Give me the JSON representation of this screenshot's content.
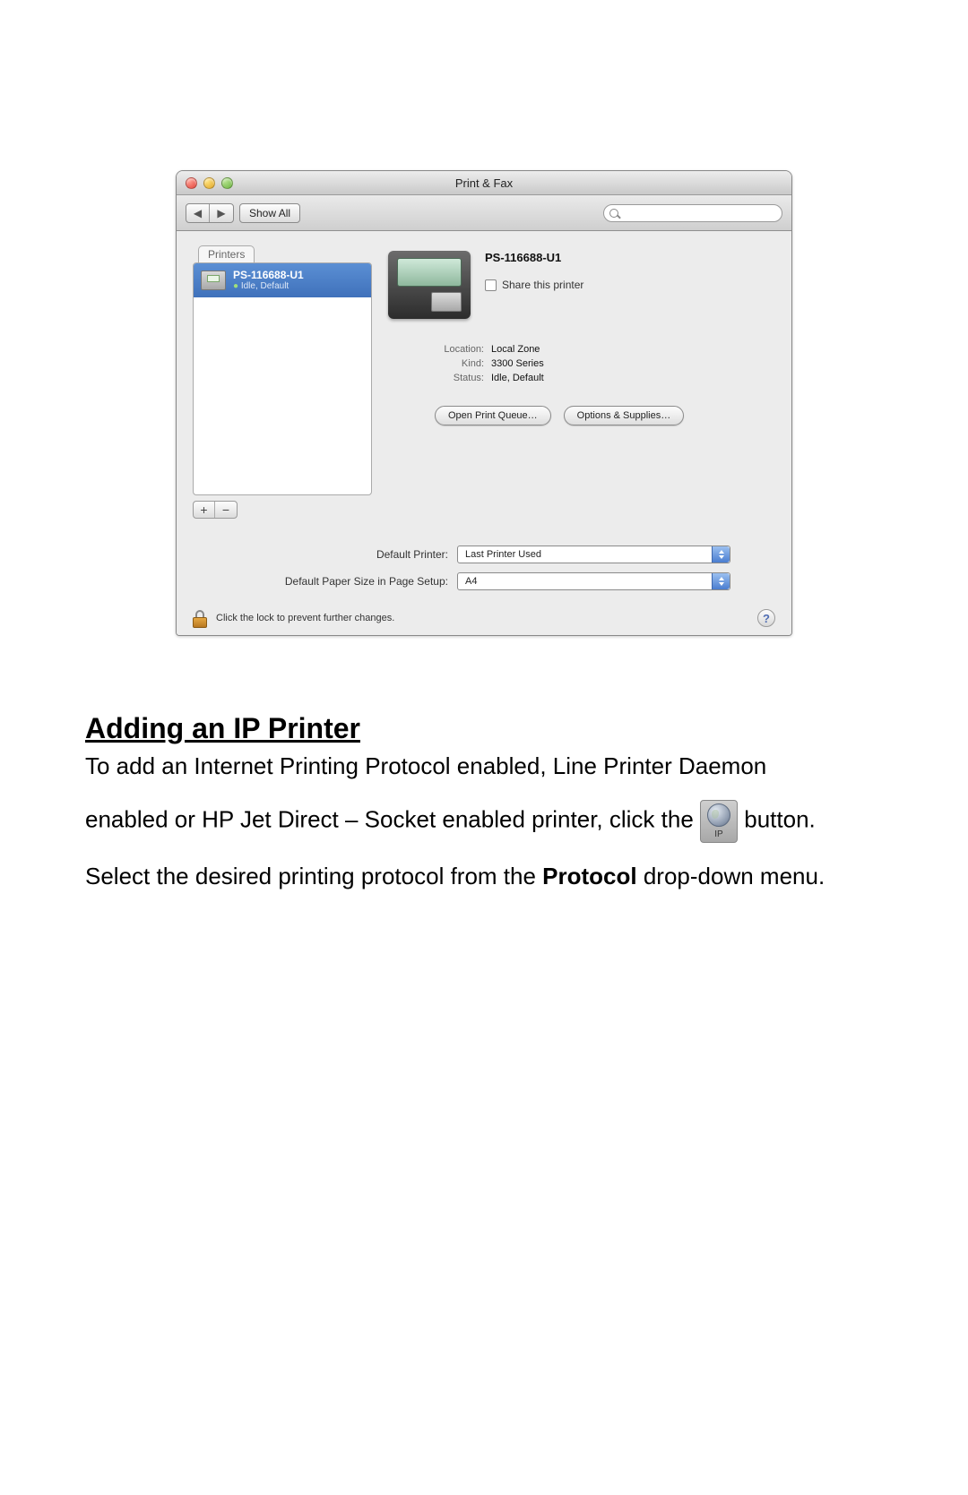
{
  "mac_window": {
    "title": "Print & Fax",
    "toolbar": {
      "show_all": "Show All"
    },
    "tab_label": "Printers",
    "selected_printer": {
      "name": "PS-116688-U1",
      "status": "Idle, Default"
    },
    "list_buttons": {
      "add": "+",
      "remove": "−"
    },
    "info": {
      "title": "PS-116688-U1",
      "share_label": "Share this printer",
      "location_label": "Location:",
      "location_val": "Local Zone",
      "kind_label": "Kind:",
      "kind_val": "3300 Series",
      "status_label": "Status:",
      "status_val": "Idle, Default",
      "btn_queue": "Open Print Queue…",
      "btn_options": "Options & Supplies…"
    },
    "settings": {
      "default_printer_label": "Default Printer:",
      "default_printer_value": "Last Printer Used",
      "paper_label": "Default Paper Size in Page Setup:",
      "paper_value": "A4"
    },
    "lock_text": "Click the lock to prevent further changes.",
    "help": "?"
  },
  "article": {
    "heading": "Adding an IP Printer",
    "p1": "To add an Internet Printing Protocol enabled, Line Printer Daemon",
    "p2_a": "enabled or HP Jet Direct – Socket enabled printer, click the",
    "ip_label": "IP",
    "p2_b": " button.",
    "p3_a": "Select the desired printing protocol from the ",
    "p3_bold": "Protocol",
    "p3_b": " drop-down menu."
  }
}
